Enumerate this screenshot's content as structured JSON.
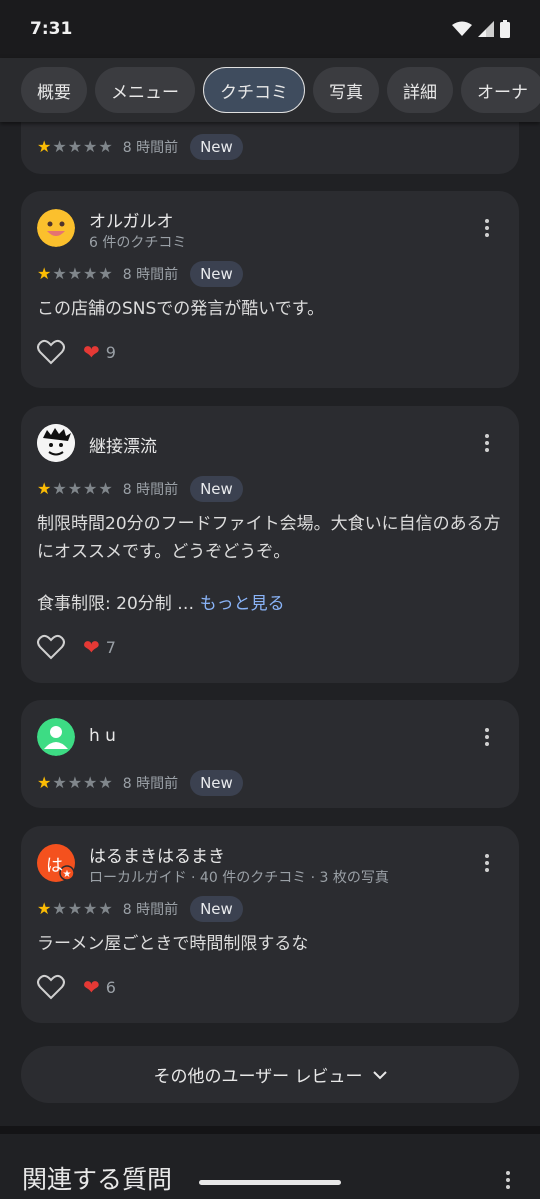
{
  "status": {
    "time": "7:31"
  },
  "tabs": [
    {
      "label": "概要"
    },
    {
      "label": "メニュー"
    },
    {
      "label": "クチコミ",
      "active": true
    },
    {
      "label": "写真"
    },
    {
      "label": "詳細"
    },
    {
      "label": "オーナ"
    }
  ],
  "reviews": [
    {
      "stars": 1,
      "time": "8 時間前",
      "badge": "New"
    },
    {
      "avatar": "smiley-avatar",
      "name": "オルガルオ",
      "sub": "6 件のクチコミ",
      "stars": 1,
      "time": "8 時間前",
      "badge": "New",
      "text": "この店舗のSNSでの発言が酷いです。",
      "likes": "9"
    },
    {
      "avatar": "manga-avatar",
      "name": "継接漂流",
      "stars": 1,
      "time": "8 時間前",
      "badge": "New",
      "text": "制限時間20分のフードファイト会場。大食いに自信のある方にオススメです。どうぞどうぞ。",
      "text2": "食事制限: 20分制 …",
      "more_link": "もっと見る",
      "likes": "7"
    },
    {
      "avatar": "default-person-avatar",
      "name": "h u",
      "stars": 1,
      "time": "8 時間前",
      "badge": "New"
    },
    {
      "avatar": "letter-avatar",
      "avatar_letter": "は",
      "name": "はるまきはるまき",
      "sub": "ローカルガイド · 40 件のクチコミ · 3 枚の写真",
      "stars": 1,
      "time": "8 時間前",
      "badge": "New",
      "text": "ラーメン屋ごときで時間制限するな",
      "likes": "6"
    }
  ],
  "more_reviews": {
    "label": "その他のユーザー レビュー"
  },
  "section": {
    "title": "関連する質問"
  },
  "colors": {
    "background": "#202124",
    "card": "#2b2c30",
    "star": "#fbbc04",
    "heart": "#e53935",
    "link": "#8ab4f8"
  }
}
